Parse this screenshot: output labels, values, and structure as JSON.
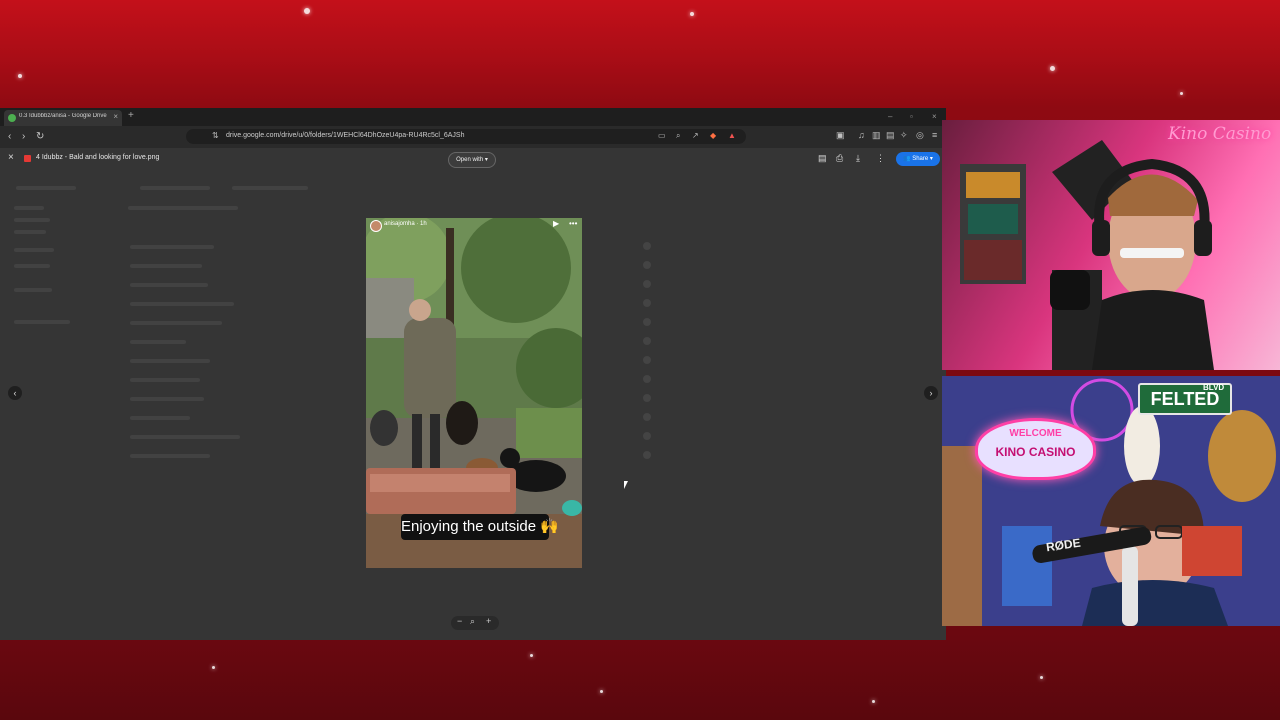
{
  "colors": {
    "background": "#a90d16",
    "share_button": "#1a73e8",
    "brand_pink": "#ff9bd0"
  },
  "browser": {
    "tab_title": "0.3 Idubbbz/anisa - Google Drive",
    "url": "drive.google.com/drive/u/0/folders/1WEHCl64DhOzeU4pa-RU4Rc5cl_6AJSh"
  },
  "viewer": {
    "file_name": "4 Idubbz - Bald and looking for love.png",
    "open_with": "Open with",
    "share": "Share"
  },
  "story": {
    "username": "anisajomha",
    "time": "1h",
    "caption": "Enjoying the outside 🙌"
  },
  "webcam": {
    "brand": "Kino Casino",
    "street_sign": "FELTED",
    "street_sign_suffix": "BLVD",
    "welcome_line1": "WELCOME",
    "welcome_line2": "KINO CASINO",
    "mic_brand": "RØDE"
  }
}
